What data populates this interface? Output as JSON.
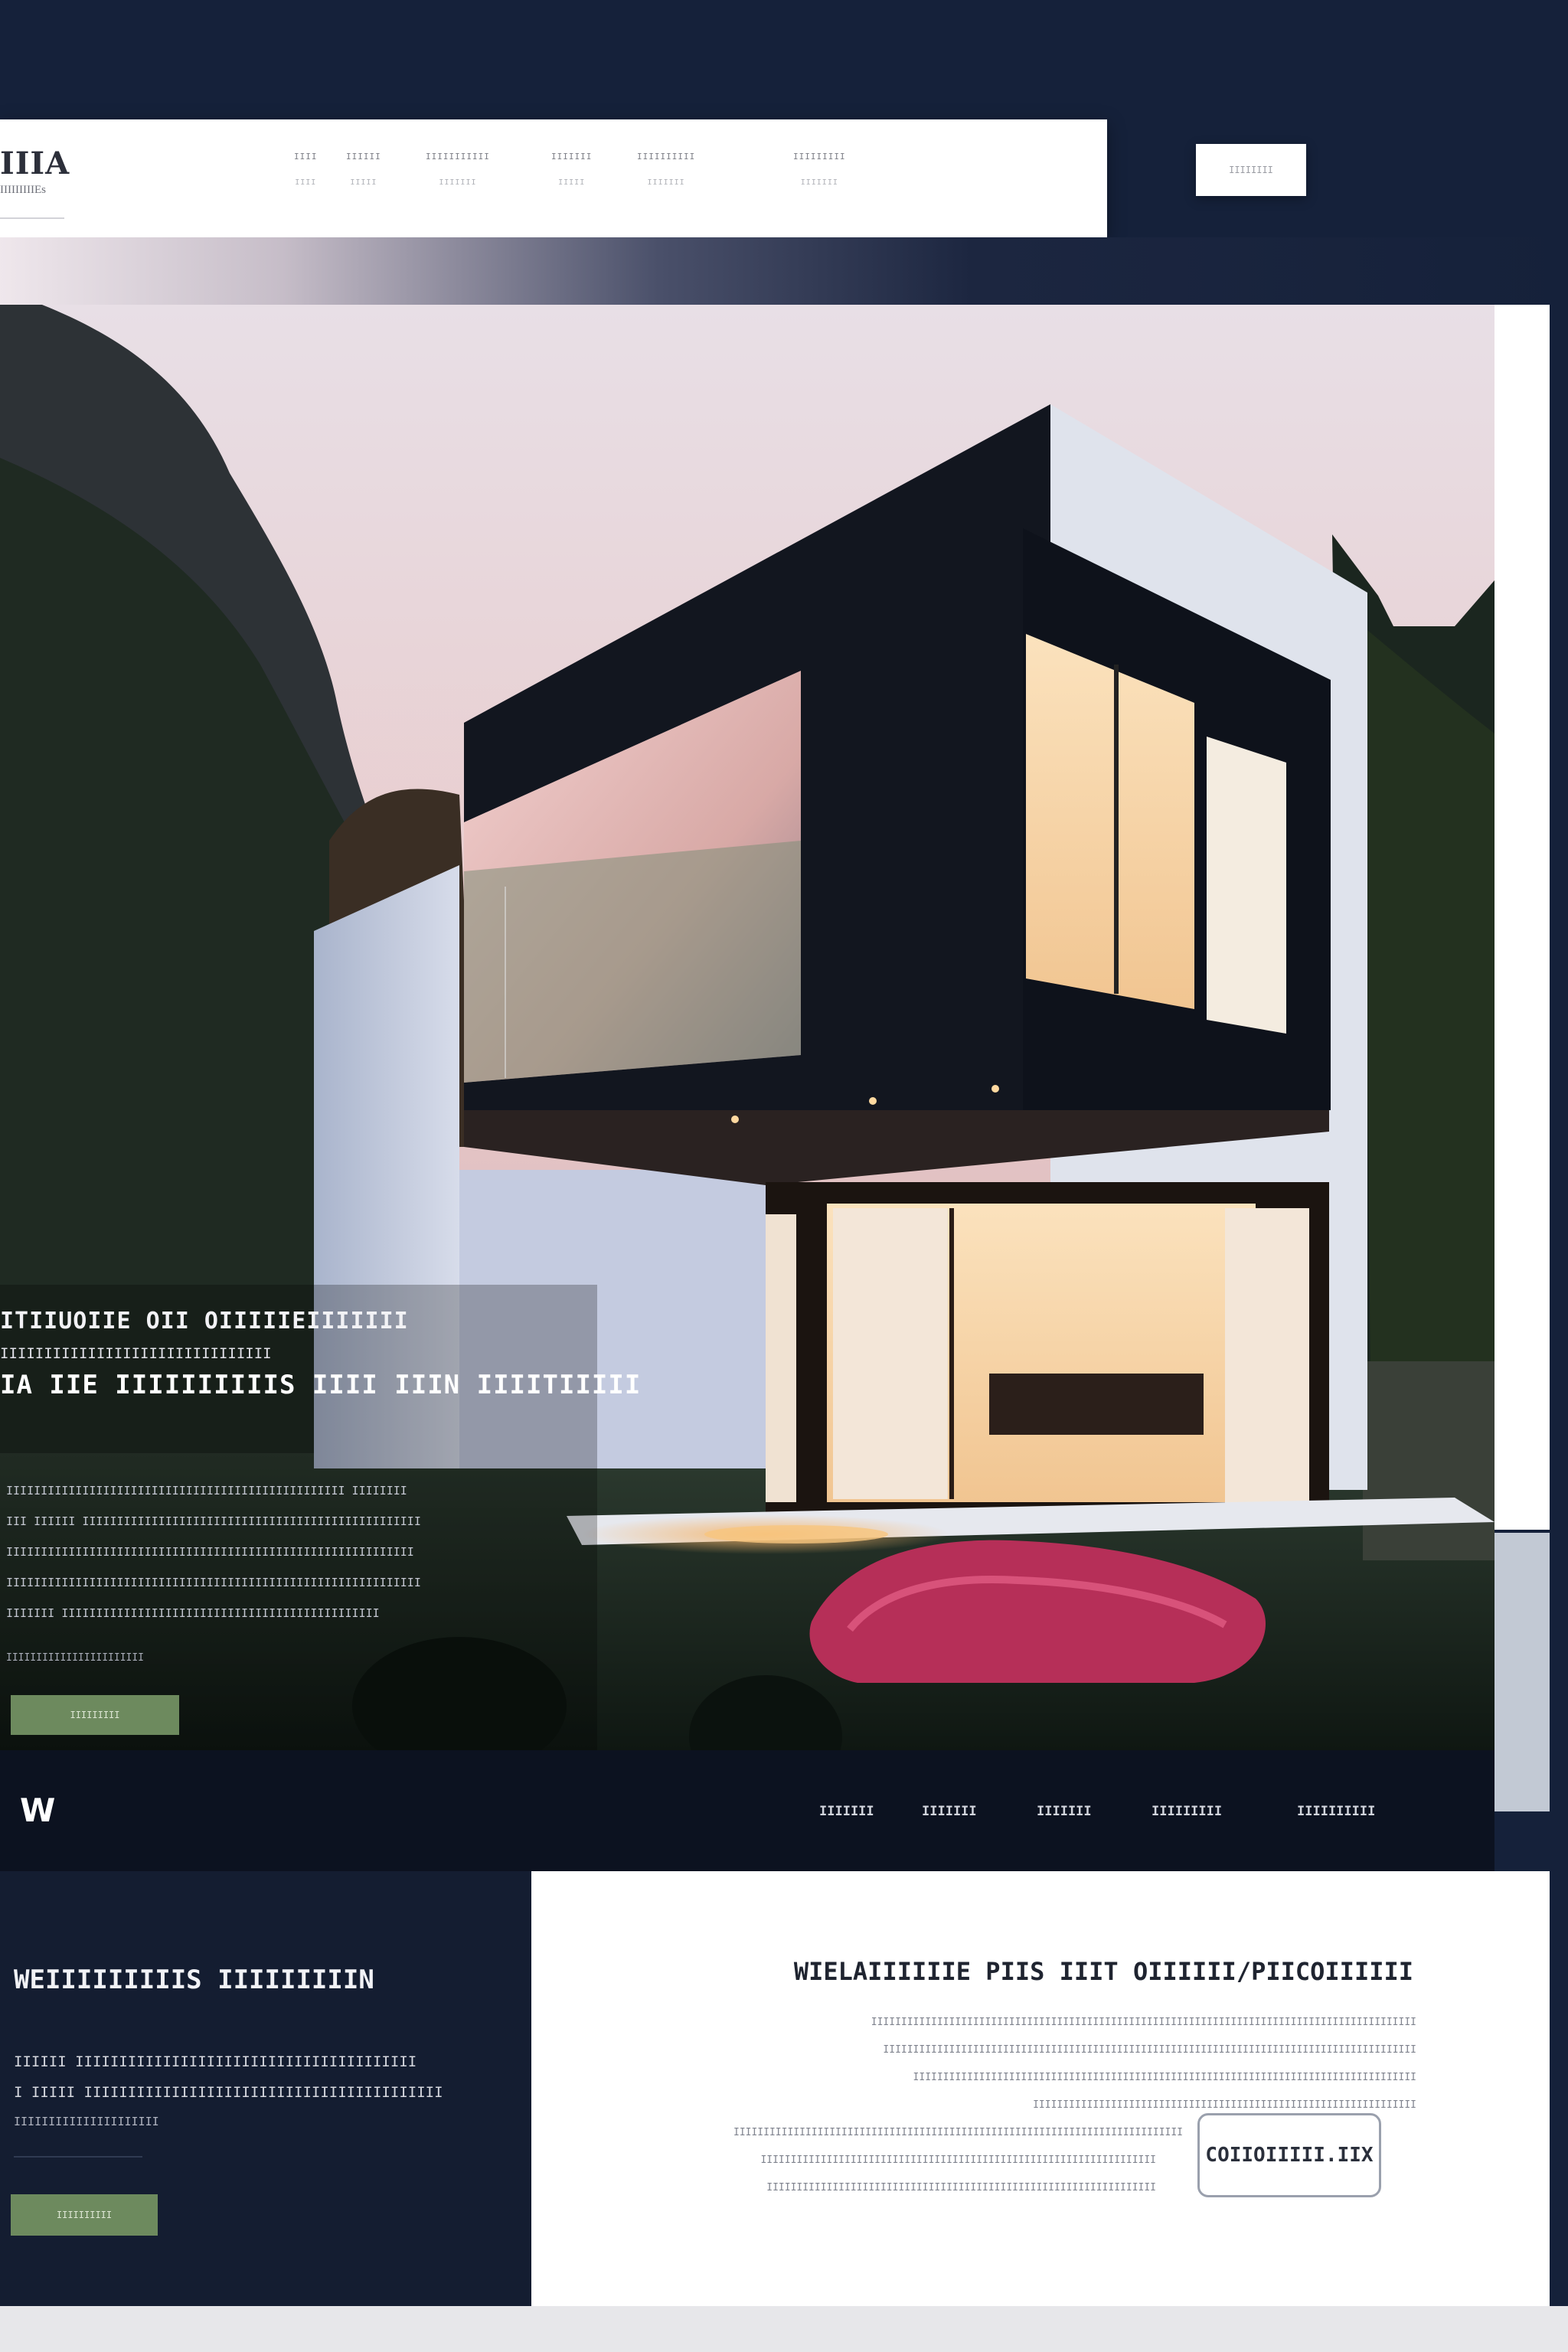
{
  "brand": {
    "mark": "IIIA",
    "sub": "IIIIIIIIIEs"
  },
  "nav": {
    "items": [
      {
        "top": "IIII",
        "sub": "IIII"
      },
      {
        "top": "IIIIII",
        "sub": "IIIII"
      },
      {
        "top": "IIIIIIIIIII",
        "sub": "IIIIIII"
      },
      {
        "top": "IIIIIII",
        "sub": "IIIII"
      },
      {
        "top": "IIIIIIIIII",
        "sub": "IIIIIII"
      },
      {
        "top": "IIIIIIIII",
        "sub": "IIIIIII"
      }
    ],
    "cta": "IIIIIIII"
  },
  "hero": {
    "eyebrow": "ITIIUOIIE OII OIIIIIEIIIIIII",
    "tagline": "IIIIIIIIIIIIIIIIIIIIIIIIIIIIIII",
    "title": "IA IIE IIIIIIIIIIS IIII IIIN IIIITIIIII",
    "body": [
      "IIIIIIIIIIIIIIIIIIIIIIIIIIIIIIIIIIIIIIIIIIIIIIIII IIIIIIII",
      "III IIIIII IIIIIIIIIIIIIIIIIIIIIIIIIIIIIIIIIIIIIIIIIIIIIIIII",
      "IIIIIIIIIIIIIIIIIIIIIIIIIIIIIIIIIIIIIIIIIIIIIIIIIIIIIIIIIII",
      "IIIIIIIIIIIIIIIIIIIIIIIIIIIIIIIIIIIIIIIIIIIIIIIIIIIIIIIIIIII",
      "IIIIIII IIIIIIIIIIIIIIIIIIIIIIIIIIIIIIIIIIIIIIIIIIIIII"
    ],
    "meta": "IIIIIIIIIIIIIIIIIIIIIII",
    "button": "IIIIIIIII"
  },
  "footer": {
    "logo": "W",
    "links": [
      "IIIIIII",
      "IIIIIII",
      "IIIIIII",
      "IIIIIIIII",
      "IIIIIIIIII"
    ]
  },
  "about": {
    "title": "WEIIIIIIIIIS IIIIIIIIIN",
    "body": [
      "IIIIII IIIIIIIIIIIIIIIIIIIIIIIIIIIIIIIIIIIIIII",
      "I IIIII IIIIIIIIIIIIIIIIIIIIIIIIIIIIIIIIIIIIIIIII"
    ],
    "small": "IIIIIIIIIIIIIIIIIIIII",
    "button": "IIIIIIIIII"
  },
  "contact": {
    "title": "WIELAIIIIIIE PIIS IIIT OIIIIII/PIICOIIIIII",
    "lines": [
      "IIIIIIIIIIIIIIIIIIIIIIIIIIIIIIIIIIIIIIIIIIIIIIIIIIIIIIIIIIIIIIIIIIIIIIIIIIIIIIIIIIIIIIIIIII",
      "IIIIIIIIIIIIIIIIIIIIIIIIIIIIIIIIIIIIIIIIIIIIIIIIIIIIIIIIIIIIIIIIIIIIIIIIIIIIIIIIIIIIIIIII",
      "IIIIIIIIIIIIIIIIIIIIIIIIIIIIIIIIIIIIIIIIIIIIIIIIIIIIIIIIIIIIIIIIIIIIIIIIIIIIIIIIIIII",
      "IIIIIIIIIIIIIIIIIIIIIIIIIIIIIIIIIIIIIIIIIIIIIIIIIIIIIIIIIIIIIIII",
      "IIIIIIIIIIIIIIIIIIIIIIIIIIIIIIIIIIIIIIIIIIIIIIIIIIIIIIIIIIIIIIIIIIIIIIIIIII",
      "IIIIIIIIIIIIIIIIIIIIIIIIIIIIIIIIIIIIIIIIIIIIIIIIIIIIIIIIIIIIIIIIII",
      "IIIIIIIIIIIIIIIIIIIIIIIIIIIIIIIIIIIIIIIIIIIIIIIIIIIIIIIIIIIIIIIII"
    ],
    "button": "COIIOIIIII.IIX"
  },
  "colors": {
    "page_bg": "#15213a",
    "accent_green": "#6d8a5e",
    "footer_bg": "#0c1220",
    "panel_dark": "#141d31"
  },
  "icons": {
    "footer_logo": "w-monogram-logo"
  }
}
